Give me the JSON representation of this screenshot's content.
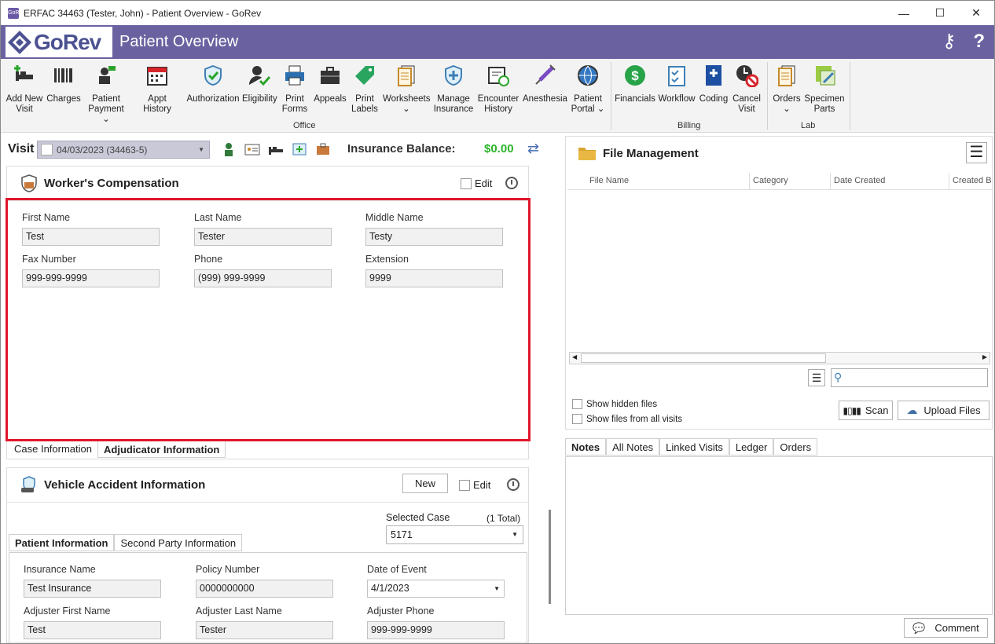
{
  "window": {
    "title": "ERFAC 34463 (Tester, John) - Patient Overview - GoRev",
    "icon_text": "GoRev"
  },
  "header": {
    "logo_text": "GoRev",
    "page_title": "Patient Overview",
    "keys_icon": "keys-icon",
    "help_icon": "?"
  },
  "ribbon": {
    "buttons": [
      {
        "label": "Add New\nVisit",
        "icon": "add-visit-icon"
      },
      {
        "label": "Charges",
        "icon": "barcode-icon"
      },
      {
        "label": "Patient\nPayment ⌄",
        "icon": "payment-icon"
      },
      {
        "label": "Appt History",
        "icon": "calendar-icon"
      },
      {
        "label": "Authorization",
        "icon": "shield-check-icon"
      },
      {
        "label": "Eligibility",
        "icon": "person-check-icon"
      },
      {
        "label": "Print\nForms",
        "icon": "printer-icon"
      },
      {
        "label": "Appeals",
        "icon": "briefcase-icon"
      },
      {
        "label": "Print\nLabels",
        "icon": "tag-icon"
      },
      {
        "label": "Worksheets\n⌄",
        "icon": "worksheets-icon"
      },
      {
        "label": "Manage\nInsurance",
        "icon": "insurance-icon"
      },
      {
        "label": "Encounter\nHistory",
        "icon": "encounter-history-icon"
      },
      {
        "label": "Anesthesia",
        "icon": "syringe-icon"
      },
      {
        "label": "Patient\nPortal ⌄",
        "icon": "globe-gear-icon"
      },
      {
        "label": "Financials",
        "icon": "dollar-icon"
      },
      {
        "label": "Workflow",
        "icon": "workflow-icon"
      },
      {
        "label": "Coding",
        "icon": "book-icon"
      },
      {
        "label": "Cancel\nVisit",
        "icon": "cancel-clock-icon"
      },
      {
        "label": "Orders\n⌄",
        "icon": "orders-icon"
      },
      {
        "label": "Specimen\nParts",
        "icon": "specimen-icon"
      }
    ],
    "groups": [
      "Office",
      "Billing",
      "Lab"
    ]
  },
  "visit": {
    "label": "Visit",
    "selected": "04/03/2023 (34463-5)",
    "insurance_balance_label": "Insurance Balance:",
    "insurance_balance_value": "$0.00"
  },
  "workers_comp": {
    "title": "Worker's Compensation",
    "edit_label": "Edit",
    "fields": [
      {
        "label": "First Name",
        "value": "Test"
      },
      {
        "label": "Last Name",
        "value": "Tester"
      },
      {
        "label": "Middle Name",
        "value": "Testy"
      },
      {
        "label": "Fax Number",
        "value": "999-999-9999"
      },
      {
        "label": "Phone",
        "value": "(999) 999-9999"
      },
      {
        "label": "Extension",
        "value": "9999"
      }
    ],
    "tabs": [
      "Case Information",
      "Adjudicator Information"
    ]
  },
  "vehicle": {
    "title": "Vehicle Accident Information",
    "new_label": "New",
    "edit_label": "Edit",
    "selected_case_label": "Selected Case",
    "total_label": "(1 Total)",
    "selected_case_value": "5171",
    "tabs": [
      "Patient Information",
      "Second Party Information"
    ],
    "fields": [
      {
        "label": "Insurance Name",
        "value": "Test Insurance"
      },
      {
        "label": "Policy Number",
        "value": "0000000000"
      },
      {
        "label": "Date of Event",
        "value": "4/1/2023"
      },
      {
        "label": "Adjuster First Name",
        "value": "Test"
      },
      {
        "label": "Adjuster Last Name",
        "value": "Tester"
      },
      {
        "label": "Adjuster Phone",
        "value": "999-999-9999"
      }
    ]
  },
  "file_management": {
    "title": "File Management",
    "columns": [
      "File Name",
      "Category",
      "Date Created",
      "Created B"
    ],
    "show_hidden": "Show hidden files",
    "show_all_visits": "Show files from all visits",
    "scan_label": "Scan",
    "upload_label": "Upload Files"
  },
  "notes": {
    "tabs": [
      "Notes",
      "All Notes",
      "Linked Visits",
      "Ledger",
      "Orders"
    ],
    "comment_label": "Comment"
  }
}
